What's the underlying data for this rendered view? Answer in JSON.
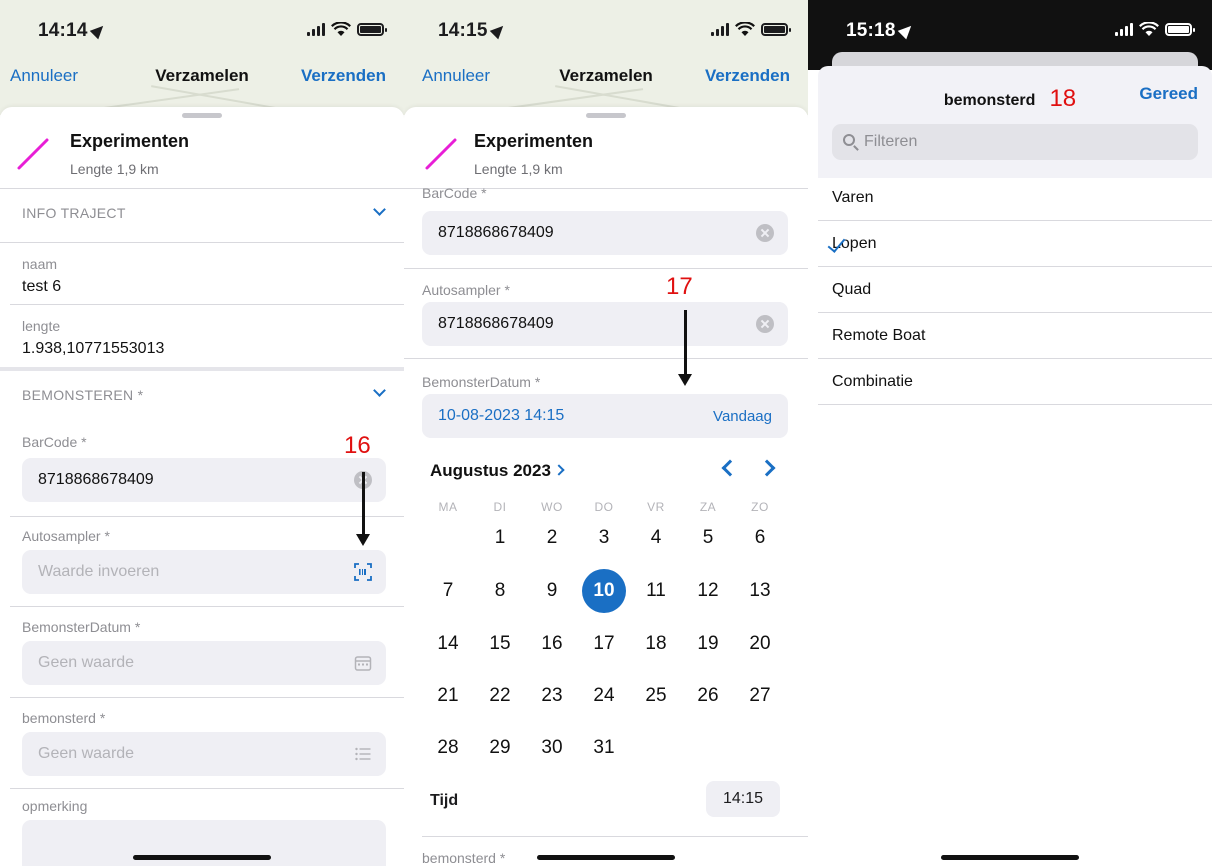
{
  "screen1": {
    "status": {
      "time": "14:14"
    },
    "nav": {
      "cancel": "Annuleer",
      "title": "Verzamelen",
      "send": "Verzenden"
    },
    "feature": {
      "title": "Experimenten",
      "subtitle": "Lengte 1,9 km"
    },
    "sections": {
      "info": "INFO TRAJECT",
      "sampling": "BEMONSTEREN *"
    },
    "fields": {
      "naam_label": "naam",
      "naam_value": "test 6",
      "lengte_label": "lengte",
      "lengte_value": "1.938,10771553013",
      "barcode_label": "BarCode *",
      "barcode_value": "8718868678409",
      "autosampler_label": "Autosampler *",
      "autosampler_placeholder": "Waarde invoeren",
      "datum_label": "BemonsterDatum *",
      "datum_placeholder": "Geen waarde",
      "bemonsterd_label": "bemonsterd *",
      "bemonsterd_placeholder": "Geen waarde",
      "opmerking_label": "opmerking"
    },
    "annotation": "16"
  },
  "screen2": {
    "status": {
      "time": "14:15"
    },
    "nav": {
      "cancel": "Annuleer",
      "title": "Verzamelen",
      "send": "Verzenden"
    },
    "feature": {
      "title": "Experimenten",
      "subtitle": "Lengte 1,9 km"
    },
    "fields": {
      "barcode_label": "BarCode *",
      "barcode_value": "8718868678409",
      "autosampler_label": "Autosampler *",
      "autosampler_value": "8718868678409",
      "datum_label": "BemonsterDatum *",
      "datum_value": "10-08-2023 14:15",
      "today": "Vandaag",
      "bemonsterd_label": "bemonsterd *"
    },
    "calendar": {
      "month": "Augustus 2023",
      "weekdays": [
        "MA",
        "DI",
        "WO",
        "DO",
        "VR",
        "ZA",
        "ZO"
      ],
      "days": [
        "1",
        "2",
        "3",
        "4",
        "5",
        "6",
        "7",
        "8",
        "9",
        "10",
        "11",
        "12",
        "13",
        "14",
        "15",
        "16",
        "17",
        "18",
        "19",
        "20",
        "21",
        "22",
        "23",
        "24",
        "25",
        "26",
        "27",
        "28",
        "29",
        "30",
        "31"
      ],
      "first_weekday_index": 1,
      "selected": "10",
      "time_label": "Tijd",
      "time_value": "14:15"
    },
    "annotation": "17"
  },
  "screen3": {
    "status": {
      "time": "15:18"
    },
    "title": "bemonsterd",
    "done": "Gereed",
    "search_placeholder": "Filteren",
    "options": [
      "Varen",
      "Lopen",
      "Quad",
      "Remote Boat",
      "Combinatie"
    ],
    "selected": "Lopen",
    "annotation": "18"
  },
  "colors": {
    "accent": "#1a6fc4",
    "annotation": "#e01010",
    "feature_line": "#e81ed6"
  }
}
